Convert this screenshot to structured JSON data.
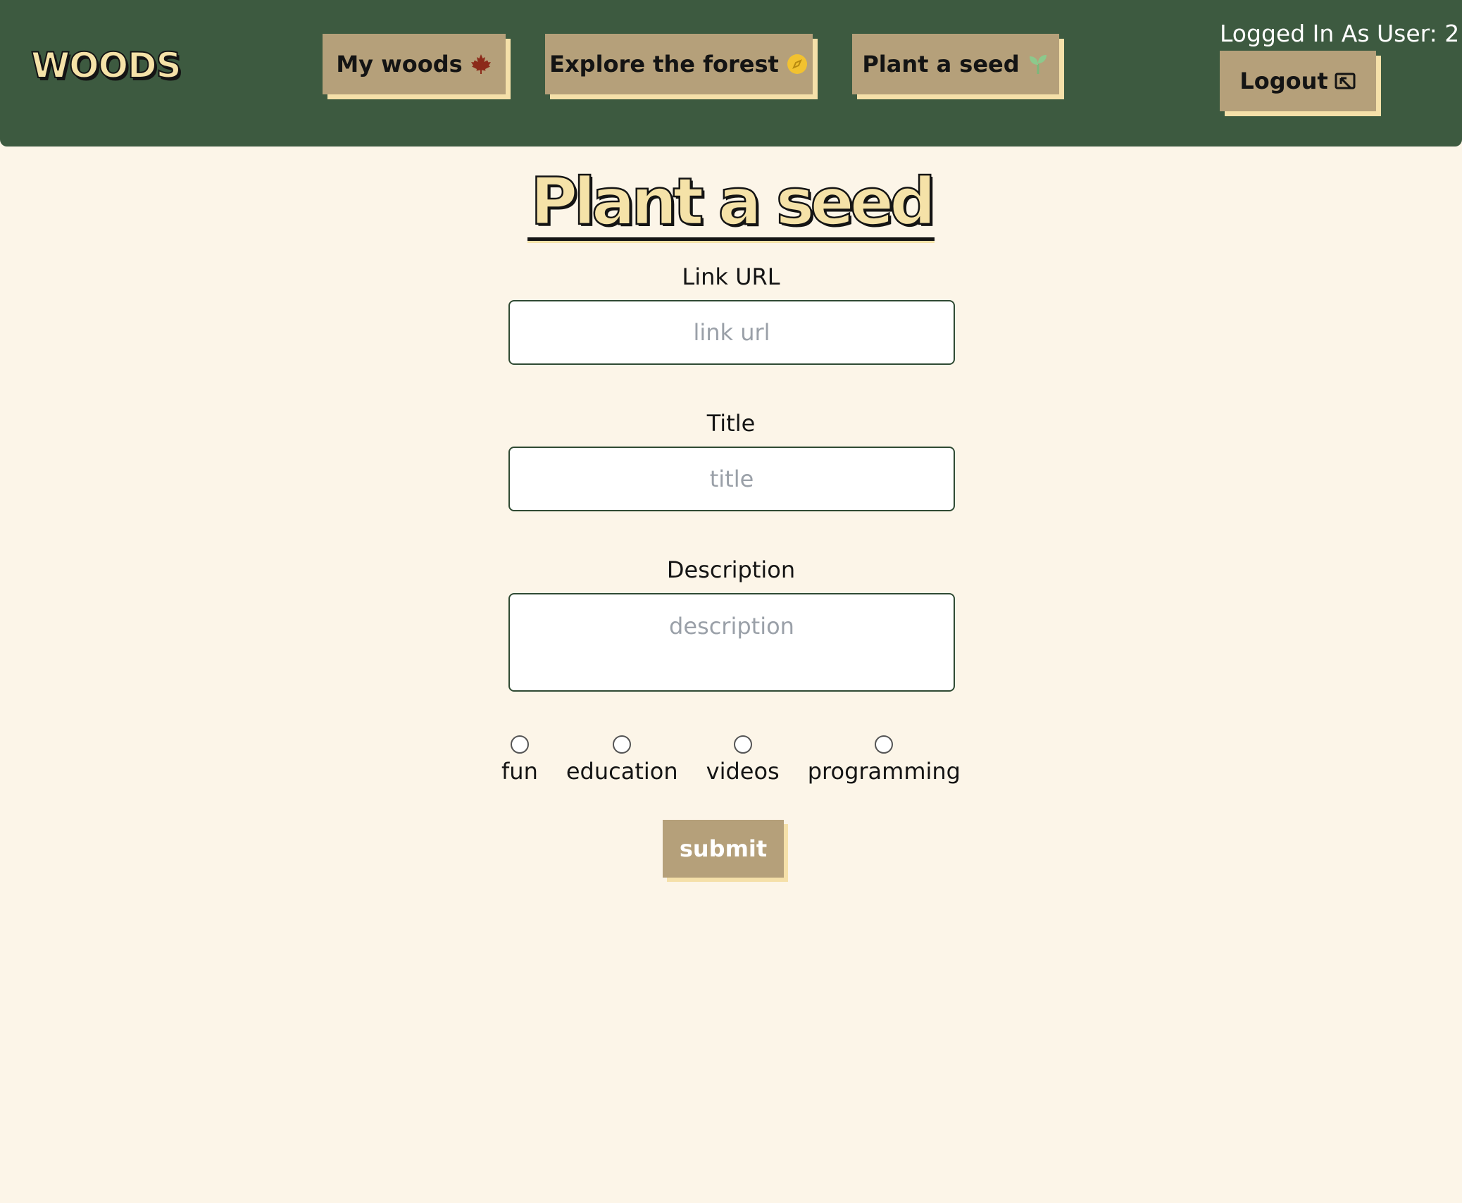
{
  "header": {
    "logo": "WOODS",
    "nav": [
      {
        "label": "My woods",
        "icon": "maple-leaf-icon"
      },
      {
        "label": "Explore the forest",
        "icon": "compass-icon"
      },
      {
        "label": "Plant a seed",
        "icon": "seedling-icon"
      }
    ],
    "login_status": "Logged In As User: 2",
    "logout_label": "Logout",
    "logout_icon": "logout-icon"
  },
  "form": {
    "title": "Plant a seed",
    "link_url": {
      "label": "Link URL",
      "placeholder": "link url",
      "value": ""
    },
    "title_field": {
      "label": "Title",
      "placeholder": "title",
      "value": ""
    },
    "description": {
      "label": "Description",
      "placeholder": "description",
      "value": ""
    },
    "categories": [
      {
        "label": "fun",
        "checked": false
      },
      {
        "label": "education",
        "checked": false
      },
      {
        "label": "videos",
        "checked": false
      },
      {
        "label": "programming",
        "checked": false
      }
    ],
    "submit_label": "submit"
  },
  "colors": {
    "header_bg": "#3d5a40",
    "page_bg": "#fcf5e8",
    "button_bg": "#b5a07a",
    "button_shadow": "#f5e0a9",
    "logo_fill": "#f5e2a8"
  }
}
